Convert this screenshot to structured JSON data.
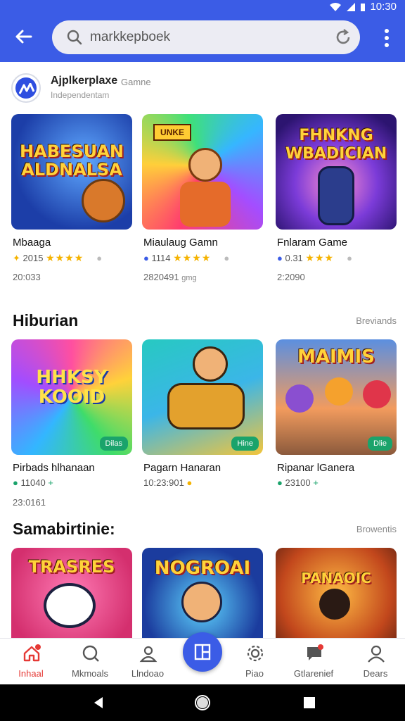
{
  "status": {
    "time": "10:30"
  },
  "appbar": {
    "search_value": "markkepboek"
  },
  "developer": {
    "name": "Ajplkerplaxe",
    "tag": "Gamne",
    "subtitle": "Independentam"
  },
  "colors": {
    "primary": "#3b5ce6",
    "star": "#f5b300",
    "badge": "#1aa36b",
    "notify": "#e53935"
  },
  "featured": [
    {
      "art": "HABESUAN ALDNALSA",
      "label": "Mbaaga",
      "rating": "2015",
      "stars": "★★★★",
      "count": "20:033"
    },
    {
      "art": "UNKE",
      "label": "Miaulaug Gamn",
      "rating": "1114",
      "stars": "★★★★",
      "count": "2820491",
      "extra": "gmg"
    },
    {
      "art": "FHNKNG WBADICIAN",
      "label": "Fnlaram Game",
      "rating": "0.31",
      "stars": "★★★",
      "count": "2:2090"
    }
  ],
  "section1": {
    "title": "Hiburian",
    "more": "Breviands"
  },
  "row2": [
    {
      "art": "HHKSY KOOID",
      "badge": "Dilas",
      "label": "Pirbads hlhanaan",
      "rating": "11040",
      "count": "23:0161"
    },
    {
      "art": "",
      "badge": "Hine",
      "label": "Pagarn Hanaran",
      "rating": "10:23:901",
      "count": ""
    },
    {
      "art": "MAIMIS",
      "badge": "Dlie",
      "label": "Ripanar lGanera",
      "rating": "23100",
      "count": ""
    }
  ],
  "section2": {
    "title": "Samabirtinie:",
    "more": "Browentis"
  },
  "row3": [
    {
      "art": "TRASRES"
    },
    {
      "art": "NOGROAI"
    },
    {
      "art": "PANAOIC"
    }
  ],
  "bottomnav": [
    {
      "label": "Inhaal",
      "icon": "home-icon"
    },
    {
      "label": "Mkmoals",
      "icon": "search-icon"
    },
    {
      "label": "Llndoao",
      "icon": "person-icon"
    },
    {
      "label": "Piao",
      "icon": "settings-icon"
    },
    {
      "label": "Gtlarenief",
      "icon": "chat-icon"
    },
    {
      "label": "Dears",
      "icon": "account-icon"
    }
  ]
}
